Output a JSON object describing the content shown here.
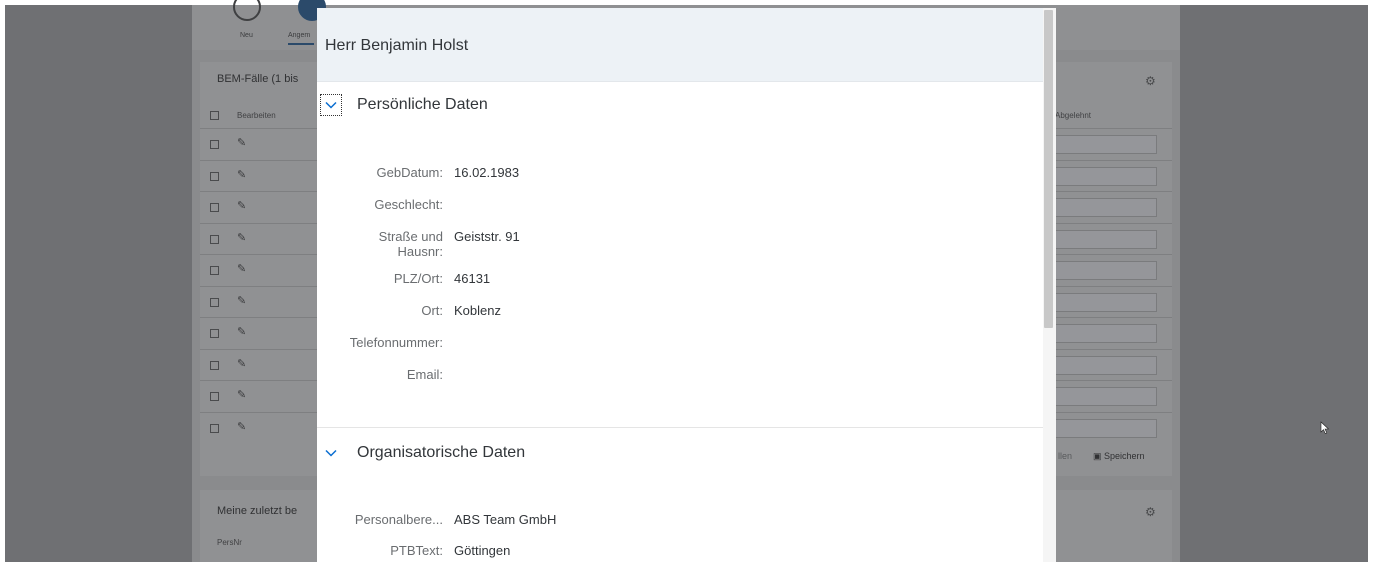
{
  "background": {
    "toolbar": {
      "new_label": "Neu",
      "second_label": "Angem"
    },
    "cases_card": {
      "title": "BEM-Fälle (1 bis",
      "col_edit": "Bearbeiten",
      "col_right": "Abgelehnt",
      "row_count": 10,
      "save_label": "Speichern",
      "cancel_label": "llen"
    },
    "recent_card": {
      "title": "Meine zuletzt be",
      "col_persnr": "PersNr"
    }
  },
  "dialog": {
    "title": "Herr Benjamin Holst",
    "personal": {
      "title": "Persönliche Daten",
      "fields": [
        {
          "label": "GebDatum:",
          "value": "16.02.1983"
        },
        {
          "label": "Geschlecht:",
          "value": ""
        },
        {
          "label": "Straße und Hausnr:",
          "value": "Geiststr. 91"
        },
        {
          "label": "PLZ/Ort:",
          "value": "46131"
        },
        {
          "label": "Ort:",
          "value": "Koblenz"
        },
        {
          "label": "Telefonnummer:",
          "value": ""
        },
        {
          "label": "Email:",
          "value": ""
        }
      ]
    },
    "organisational": {
      "title": "Organisatorische Daten",
      "fields": [
        {
          "label": "Personalbere...",
          "value": "ABS Team GmbH"
        },
        {
          "label": "PTBText:",
          "value": "Göttingen"
        }
      ]
    }
  }
}
